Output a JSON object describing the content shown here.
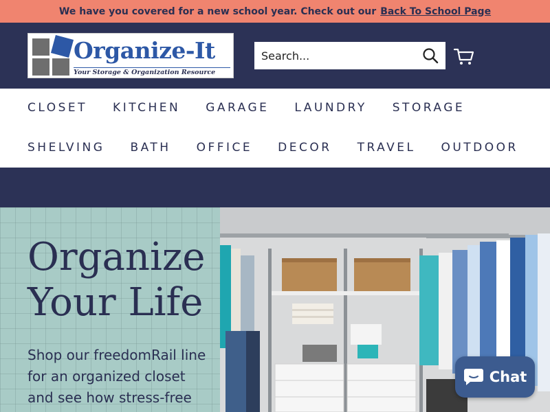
{
  "announcement": {
    "text": "We have you covered for a new school year. Check out our",
    "link": "Back To School Page"
  },
  "logo": {
    "title": "Organize-It",
    "tagline": "Your Storage & Organization Resource"
  },
  "search": {
    "placeholder": "Search..."
  },
  "icons": {
    "search": "search-icon",
    "cart": "cart-icon",
    "chat": "chat-bubble-icon"
  },
  "nav": {
    "row1": [
      "CLOSET",
      "KITCHEN",
      "GARAGE",
      "LAUNDRY",
      "STORAGE"
    ],
    "row2": [
      "SHELVING",
      "BATH",
      "OFFICE",
      "DECOR",
      "TRAVEL",
      "OUTDOOR"
    ]
  },
  "hero": {
    "title_line1": "Organize",
    "title_line2": "Your Life",
    "text_line1": "Shop our freedomRail line",
    "text_line2": "for an organized closet",
    "text_line3": "and see how stress-free"
  },
  "chat": {
    "label": "Chat"
  },
  "colors": {
    "announcement_bg": "#f0846f",
    "navy": "#2c3256",
    "hero_bg": "#a8cbc6",
    "brand_blue": "#2d58a6",
    "chat_bg": "#3c5b8f"
  }
}
